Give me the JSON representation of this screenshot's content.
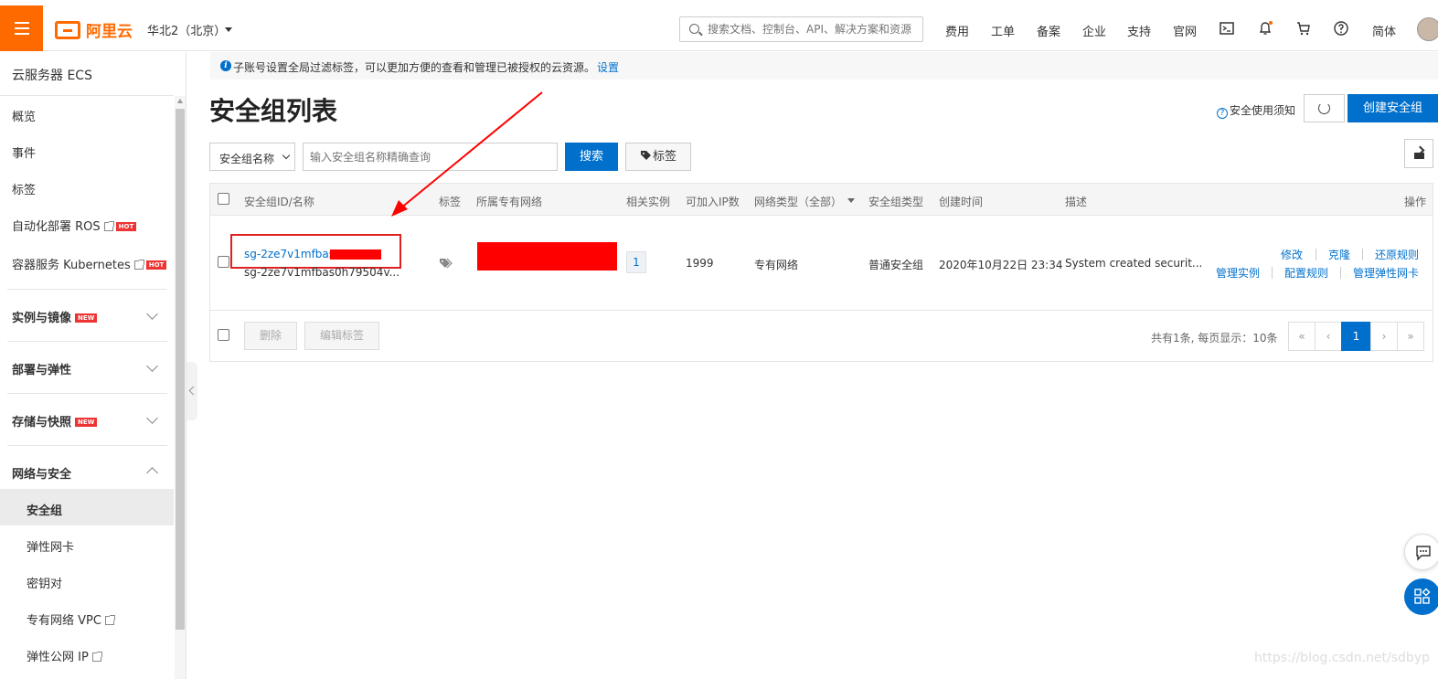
{
  "topbar": {
    "brand": "阿里云",
    "region": "华北2（北京）",
    "search_placeholder": "搜索文档、控制台、API、解决方案和资源",
    "nav": [
      "费用",
      "工单",
      "备案",
      "企业",
      "支持",
      "官网"
    ],
    "lang": "简体"
  },
  "sidebar": {
    "title": "云服务器 ECS",
    "items": [
      "概览",
      "事件",
      "标签",
      "自动化部署 ROS",
      "容器服务 Kubernetes"
    ],
    "hot_badge": "HOT",
    "new_badge": "NEW",
    "groups": [
      "实例与镜像",
      "部署与弹性",
      "存储与快照",
      "网络与安全"
    ],
    "sub_items": [
      "安全组",
      "弹性网卡",
      "密钥对",
      "专有网络 VPC",
      "弹性公网 IP"
    ]
  },
  "notice": {
    "text": "子账号设置全局过滤标签，可以更加方便的查看和管理已被授权的云资源。",
    "link": "设置"
  },
  "page": {
    "title": "安全组列表",
    "help_link": "安全使用须知",
    "create_button": "创建安全组"
  },
  "filter": {
    "select_value": "安全组名称",
    "input_placeholder": "输入安全组名称精确查询",
    "search_button": "搜索",
    "tag_button": "标签"
  },
  "table": {
    "headers": [
      "安全组ID/名称",
      "标签",
      "所属专有网络",
      "相关实例",
      "可加入IP数",
      "网络类型（全部）",
      "安全组类型",
      "创建时间",
      "描述",
      "操作"
    ],
    "rows": [
      {
        "id": "sg-2ze7v1mfbas0",
        "name": "sg-2ze7v1mfbas0h79504v...",
        "related_instances": "1",
        "ip_count": "1999",
        "network_type": "专有网络",
        "group_type": "普通安全组",
        "created": "2020年10月22日 23:34",
        "description": "System created securit...",
        "actions_row1": [
          "修改",
          "克隆",
          "还原规则"
        ],
        "actions_row2": [
          "管理实例",
          "配置规则",
          "管理弹性网卡"
        ]
      }
    ],
    "footer_buttons": [
      "删除",
      "编辑标签"
    ],
    "pagination_summary": "共有1条, 每页显示：10条",
    "pages": [
      "«",
      "‹",
      "1",
      "›",
      "»"
    ]
  },
  "watermark": "https://blog.csdn.net/sdbyp",
  "colors": {
    "accent": "#ff6a00",
    "primary": "#0070cc",
    "redaction": "#ff0000"
  }
}
